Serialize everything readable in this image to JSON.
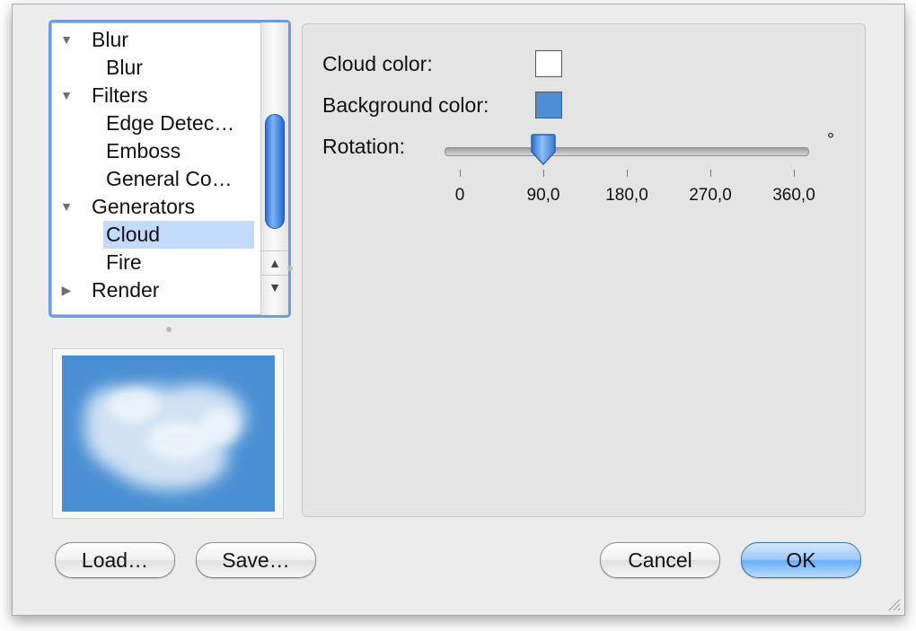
{
  "tree": {
    "items": [
      {
        "label": "Blur",
        "level": 0,
        "disclosure": "expanded"
      },
      {
        "label": "Blur",
        "level": 1
      },
      {
        "label": "Filters",
        "level": 0,
        "disclosure": "expanded"
      },
      {
        "label": "Edge Detec…",
        "level": 1
      },
      {
        "label": "Emboss",
        "level": 1
      },
      {
        "label": "General Co…",
        "level": 1
      },
      {
        "label": "Generators",
        "level": 0,
        "disclosure": "expanded"
      },
      {
        "label": "Cloud",
        "level": 1,
        "selected": true
      },
      {
        "label": "Fire",
        "level": 1
      },
      {
        "label": "Render",
        "level": 0,
        "disclosure": "collapsed"
      }
    ],
    "icons": {
      "expanded": "triangle-down-icon",
      "collapsed": "triangle-right-icon",
      "scroll_up": "arrow-up-icon",
      "scroll_down": "arrow-down-icon"
    }
  },
  "preview": {
    "background_color": "#4a8fd3",
    "content": "cloud"
  },
  "options": {
    "cloud_color_label": "Cloud color:",
    "cloud_color": "#ffffff",
    "background_color_label": "Background color:",
    "background_color": "#4d8fd4",
    "rotation_label": "Rotation:",
    "rotation_value": 90,
    "rotation_min": 0,
    "rotation_max": 360,
    "rotation_unit": "°",
    "ticks": [
      "0",
      "90,0",
      "180,0",
      "270,0",
      "360,0"
    ]
  },
  "buttons": {
    "load": "Load…",
    "save": "Save…",
    "cancel": "Cancel",
    "ok": "OK"
  },
  "colors": {
    "selection": "#c4dafa",
    "focus_ring": "#6b9ee0",
    "accent": "#4a8fd3"
  }
}
